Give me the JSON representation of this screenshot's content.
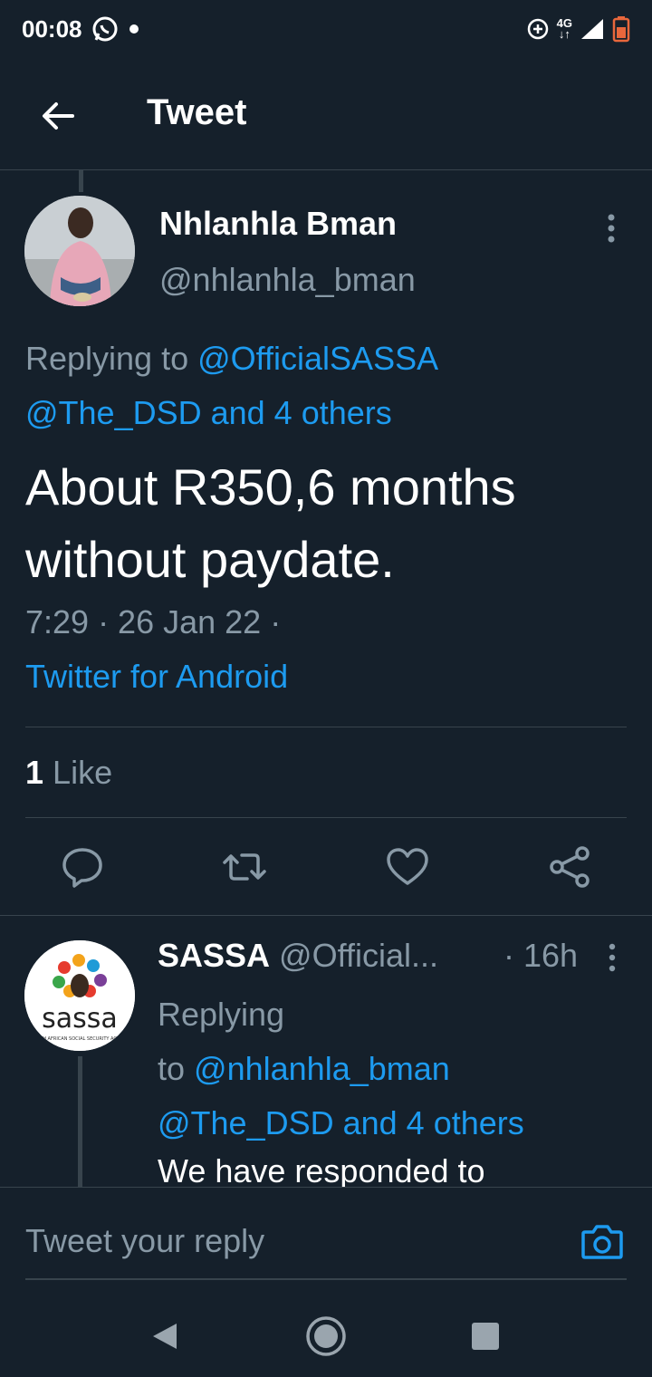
{
  "status_bar": {
    "time": "00:08",
    "network": "4G",
    "icons": [
      "whatsapp-icon",
      "notification-dot-icon",
      "data-saver-icon",
      "network-arrows-icon",
      "signal-icon",
      "battery-icon"
    ]
  },
  "app_bar": {
    "title": "Tweet",
    "back_icon": "arrow-left-icon"
  },
  "tweet": {
    "author_name": "Nhlanhla Bman",
    "author_handle": "@nhlanhla_bman",
    "replying_label": "Replying to",
    "replying_to_1": "@OfficialSASSA",
    "replying_to_2": "@The_DSD and 4 others",
    "text": "About R350,6 months without paydate.",
    "time": "7:29 · 26 Jan 22 ·",
    "source": "Twitter for Android",
    "like_count": "1",
    "like_label": "Like",
    "actions": [
      "reply-icon",
      "retweet-icon",
      "like-icon",
      "share-icon"
    ]
  },
  "reply": {
    "name": "SASSA",
    "handle": "@Official...",
    "time": "· 16h",
    "replying_label": "Replying",
    "replying_to_prefix": "to",
    "replying_to_1": "@nhlanhla_bman",
    "replying_to_2": "@The_DSD and 4 others",
    "text": "We have responded to",
    "logo_text": "sassa",
    "logo_subtext": "SOUTH AFRICAN SOCIAL SECURITY AGENCY"
  },
  "reply_bar": {
    "placeholder": "Tweet your reply",
    "camera_icon": "camera-icon"
  },
  "nav_bar": {
    "icons": [
      "back-triangle-icon",
      "home-circle-icon",
      "recents-square-icon"
    ]
  },
  "colors": {
    "background": "#15202b",
    "accent": "#1d9bf0",
    "secondary_text": "#8899a6",
    "divider": "#38444d"
  }
}
